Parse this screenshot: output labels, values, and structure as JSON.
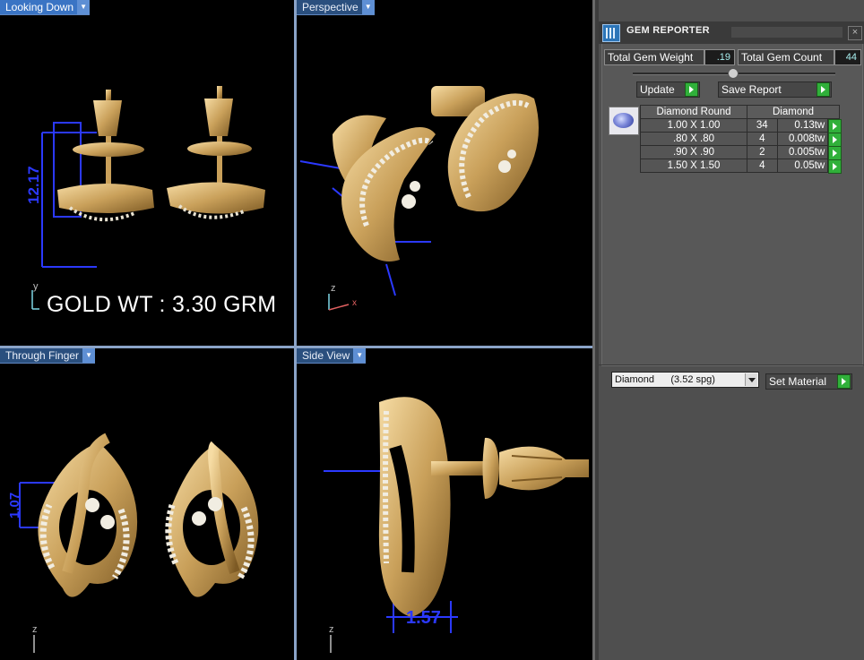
{
  "viewports": {
    "top_left": {
      "label": "Looking Down",
      "dimension": "12.17",
      "overlay_text": "GOLD WT : 3.30 GRM",
      "axis_label": "y"
    },
    "top_right": {
      "label": "Perspective",
      "axis_y": "z",
      "axis_x": "x"
    },
    "bottom_left": {
      "label": "Through Finger",
      "dimension": "1.07",
      "axis_label": "z"
    },
    "bottom_right": {
      "label": "Side View",
      "dimension": "1.57",
      "axis_label": "z"
    }
  },
  "gem_reporter": {
    "title": "GEM REPORTER",
    "close_glyph": "×",
    "total_weight_label": "Total Gem Weight",
    "total_weight_value": ".19",
    "total_count_label": "Total Gem Count",
    "total_count_value": "44",
    "update_label": "Update",
    "save_report_label": "Save Report",
    "table": {
      "headers": [
        "Diamond Round",
        "Diamond"
      ],
      "rows": [
        {
          "size": "1.00 X 1.00",
          "count": "34",
          "weight": "0.13tw"
        },
        {
          "size": ".80 X .80",
          "count": "4",
          "weight": "0.008tw"
        },
        {
          "size": ".90 X .90",
          "count": "2",
          "weight": "0.005tw"
        },
        {
          "size": "1.50 X 1.50",
          "count": "4",
          "weight": "0.05tw"
        }
      ]
    },
    "material_select": "Diamond      (3.52 spg)",
    "set_material_label": "Set Material"
  },
  "colors": {
    "gold": "#c9a05a",
    "dimension_blue": "#2b39ff",
    "panel_bg": "#4f4f4f",
    "accent_green": "#30b03a"
  }
}
